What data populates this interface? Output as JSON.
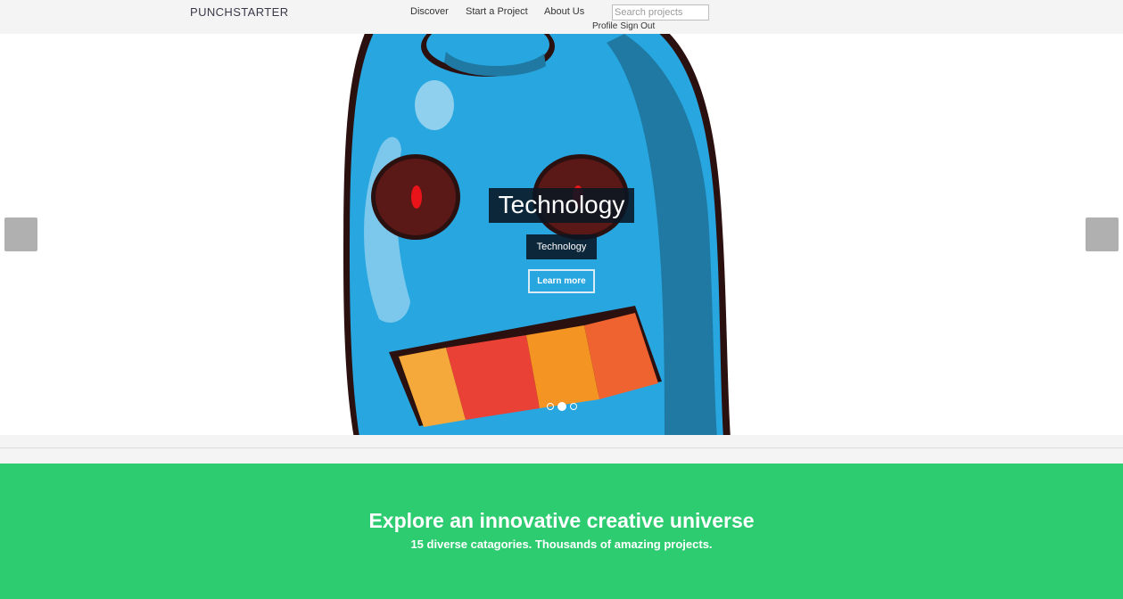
{
  "nav": {
    "brand": "PUNCHSTARTER",
    "links": [
      "Discover",
      "Start a Project",
      "About Us"
    ],
    "search_placeholder": "Search projects",
    "user_links": [
      "Profile",
      "Sign Out"
    ]
  },
  "hero": {
    "title": "Technology",
    "subtitle": "Technology",
    "button_label": "Learn more",
    "slides_count": 3,
    "active_slide": 2
  },
  "explore": {
    "heading": "Explore an innovative creative universe",
    "subheading": "15 diverse catagories. Thousands of amazing projects."
  },
  "colors": {
    "accent_green": "#2ecc71",
    "robot_blue": "#27a6e0",
    "caption_bg": "#0a1622"
  },
  "icons": {
    "prev": "carousel-prev-button",
    "next": "carousel-next-button"
  }
}
